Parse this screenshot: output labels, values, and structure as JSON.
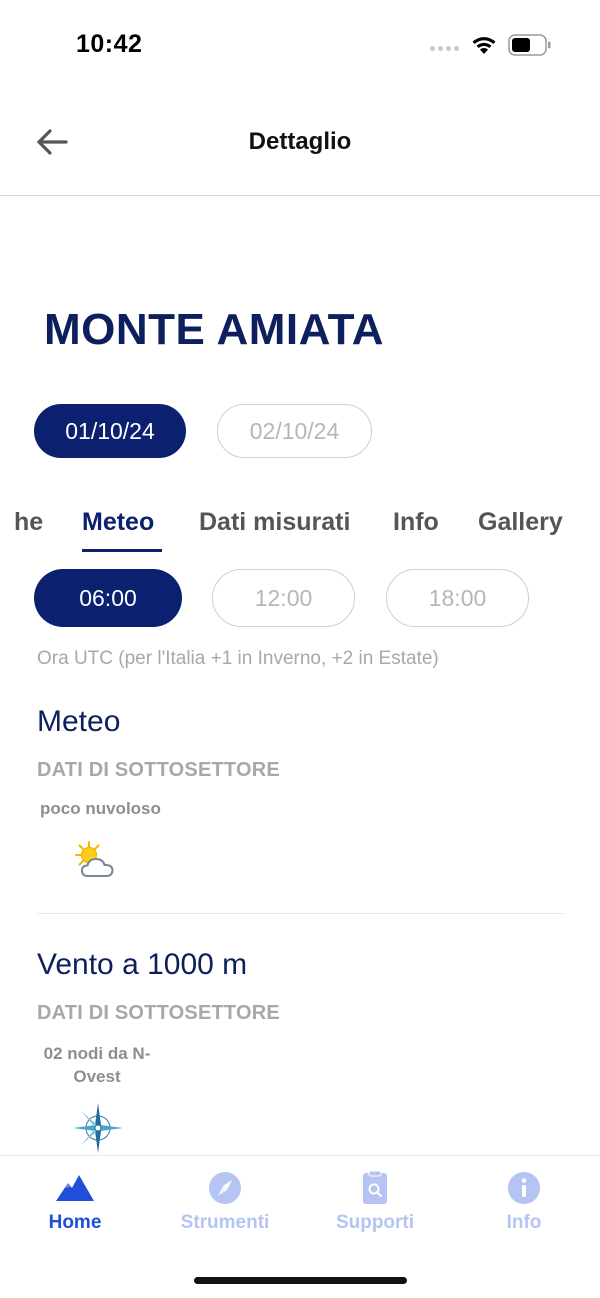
{
  "status_bar": {
    "time": "10:42"
  },
  "header": {
    "title": "Dettaglio"
  },
  "page": {
    "title": "MONTE AMIATA"
  },
  "dates": [
    {
      "label": "01/10/24",
      "selected": true
    },
    {
      "label": "02/10/24",
      "selected": false
    }
  ],
  "tabs": [
    {
      "label": "he",
      "selected": false
    },
    {
      "label": "Meteo",
      "selected": true
    },
    {
      "label": "Dati misurati",
      "selected": false
    },
    {
      "label": "Info",
      "selected": false
    },
    {
      "label": "Gallery",
      "selected": false
    }
  ],
  "times": [
    {
      "label": "06:00",
      "selected": true
    },
    {
      "label": "12:00",
      "selected": false
    },
    {
      "label": "18:00",
      "selected": false
    }
  ],
  "utc_note": "Ora UTC (per l'Italia +1 in Inverno, +2 in Estate)",
  "meteo": {
    "title": "Meteo",
    "subtitle": "DATI DI SOTTOSETTORE",
    "condition": "poco nuvoloso",
    "icon": "partly-cloudy-icon"
  },
  "wind": {
    "title": "Vento a 1000 m",
    "subtitle": "DATI DI SOTTOSETTORE",
    "value_line1": "02 nodi da N-",
    "value_line2": "Ovest",
    "icon": "compass-rose-icon"
  },
  "bottom_nav": [
    {
      "label": "Home",
      "icon": "mountain-icon",
      "active": true
    },
    {
      "label": "Strumenti",
      "icon": "compass-icon",
      "active": false
    },
    {
      "label": "Supporti",
      "icon": "clipboard-search-icon",
      "active": false
    },
    {
      "label": "Info",
      "icon": "info-icon",
      "active": false
    }
  ],
  "colors": {
    "primary": "#0b2170",
    "title": "#0d1f5c",
    "nav_active": "#1f4fd8",
    "nav_inactive": "#b5c4f2"
  }
}
